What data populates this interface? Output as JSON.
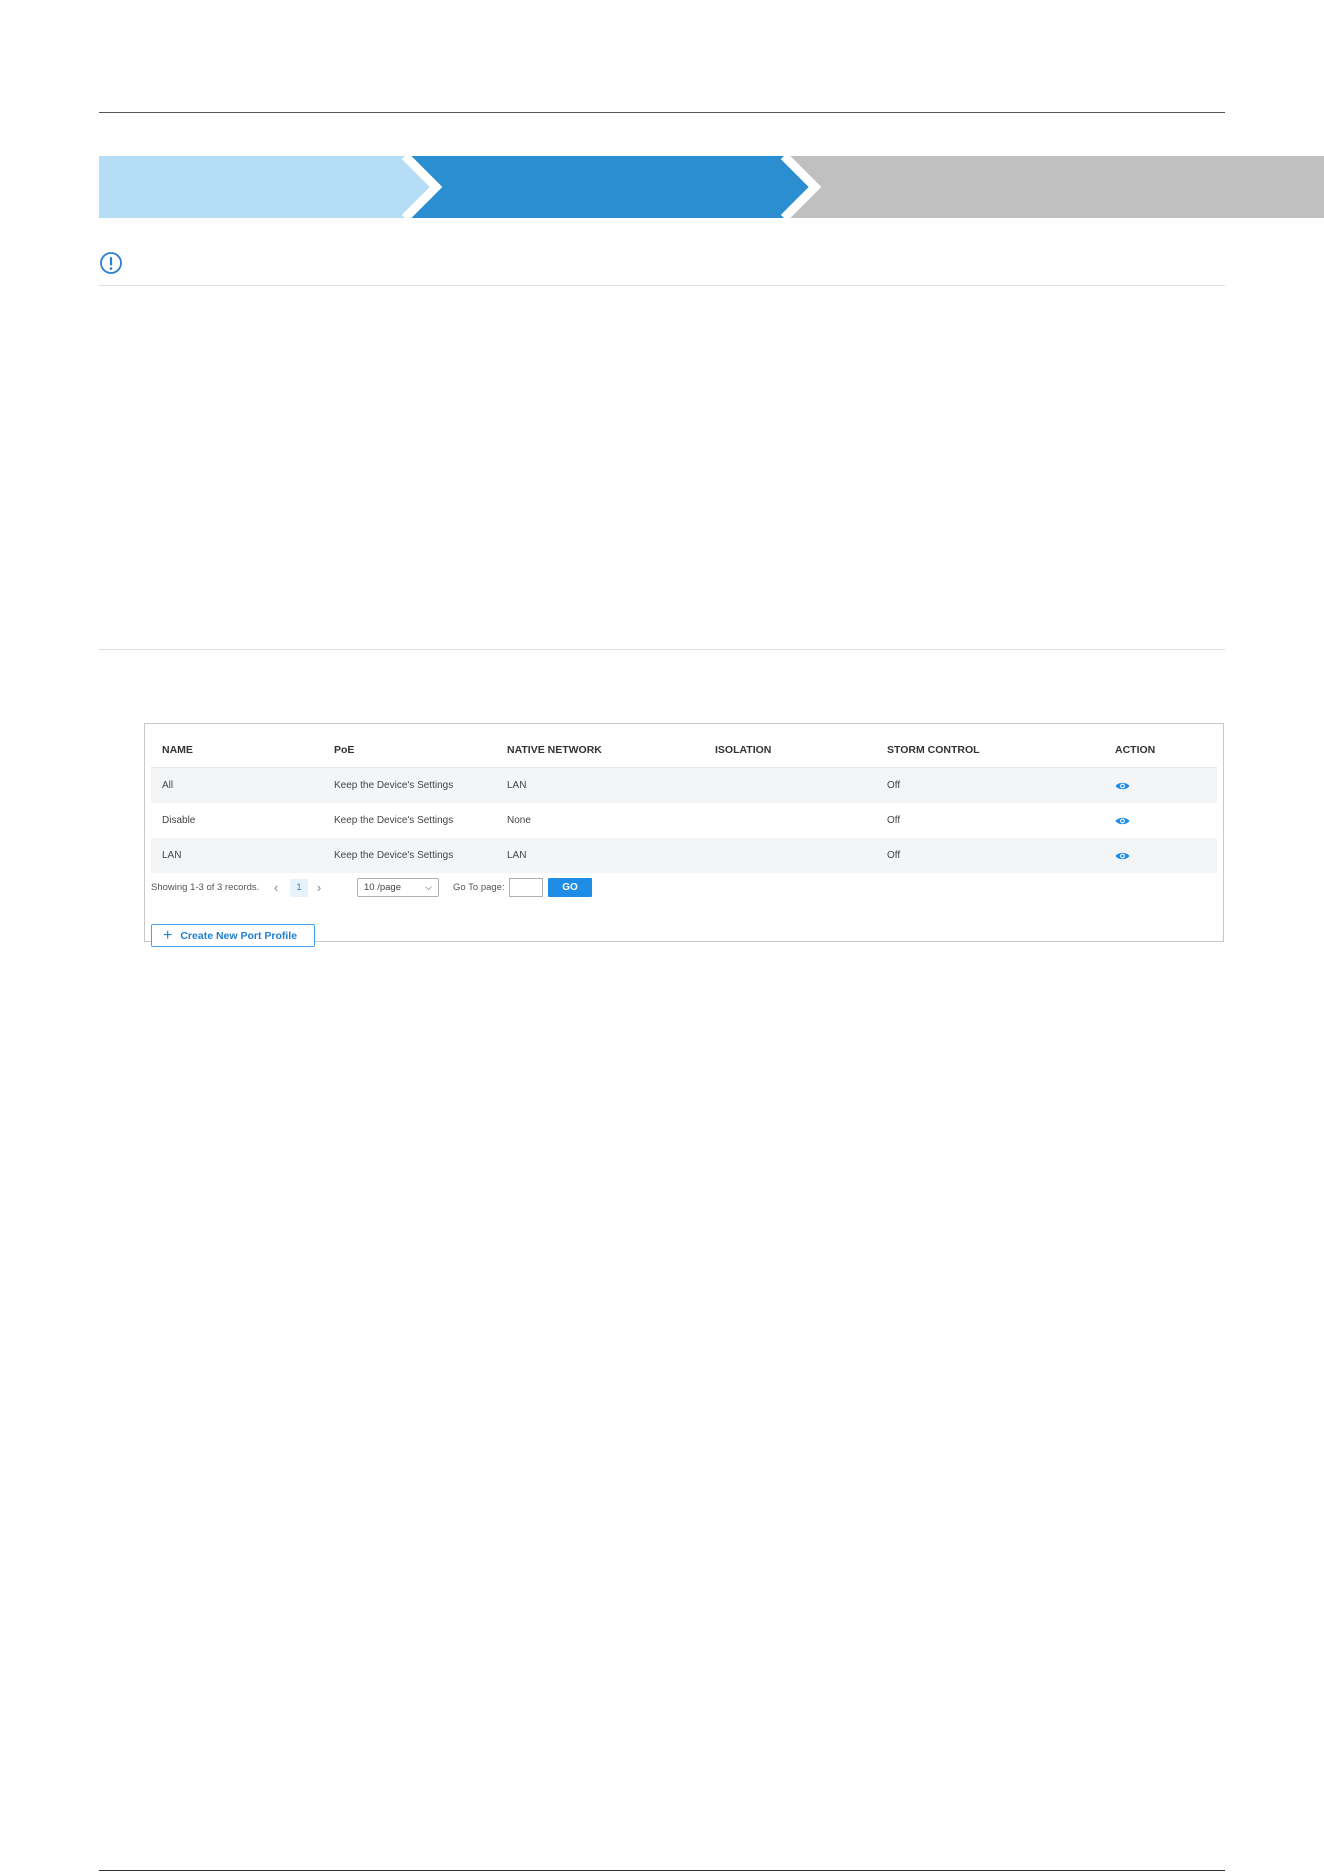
{
  "colors": {
    "step_done": "#b5ddf6",
    "step_active": "#2b8ed0",
    "step_pending": "#c0c0c0",
    "accent": "#1f8ce6"
  },
  "icons": {
    "note": "exclamation-circle-icon",
    "action": "eye-icon",
    "prev": "chevron-left-icon",
    "next": "chevron-right-icon",
    "dropdown": "chevron-down-icon",
    "add": "plus-icon"
  },
  "table": {
    "columns": [
      "NAME",
      "PoE",
      "NATIVE NETWORK",
      "ISOLATION",
      "STORM CONTROL",
      "ACTION"
    ],
    "rows": [
      {
        "name": "All",
        "poe": "Keep the Device's Settings",
        "native": "LAN",
        "isolation": "",
        "storm": "Off"
      },
      {
        "name": "Disable",
        "poe": "Keep the Device's Settings",
        "native": "None",
        "isolation": "",
        "storm": "Off"
      },
      {
        "name": "LAN",
        "poe": "Keep the Device's Settings",
        "native": "LAN",
        "isolation": "",
        "storm": "Off"
      }
    ]
  },
  "pagination": {
    "showing": "Showing 1-3 of 3 records.",
    "prev": "‹",
    "current_page": "1",
    "next": "›",
    "per_page": "10 /page",
    "goto_label": "Go To page:",
    "go_label": "GO"
  },
  "create_button": {
    "icon": "+",
    "label": "Create New Port Profile"
  }
}
